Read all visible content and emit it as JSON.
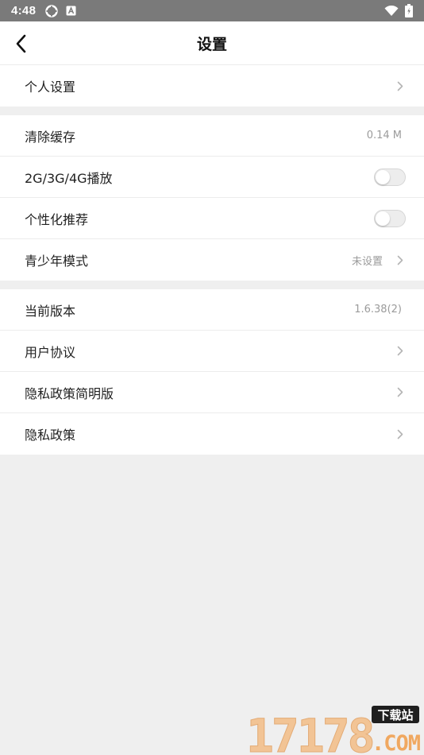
{
  "status_bar": {
    "time": "4:48",
    "left_icons": [
      "sync-icon",
      "app-notification-icon"
    ],
    "right_icons": [
      "wifi-icon",
      "battery-icon"
    ],
    "background_color": "#7a7a7a"
  },
  "nav": {
    "back_icon": "chevron-left-icon",
    "title": "设置"
  },
  "groups": [
    {
      "rows": [
        {
          "label": "个人设置",
          "value": "",
          "control": "chevron"
        }
      ]
    },
    {
      "rows": [
        {
          "label": "清除缓存",
          "value": "0.14 M",
          "control": "none"
        },
        {
          "label": "2G/3G/4G播放",
          "value": "",
          "control": "toggle",
          "on": false
        },
        {
          "label": "个性化推荐",
          "value": "",
          "control": "toggle",
          "on": false
        },
        {
          "label": "青少年模式",
          "value": "未设置",
          "control": "chevron"
        }
      ]
    },
    {
      "rows": [
        {
          "label": "当前版本",
          "value": "1.6.38(2)",
          "control": "none"
        },
        {
          "label": "用户协议",
          "value": "",
          "control": "chevron"
        },
        {
          "label": "隐私政策简明版",
          "value": "",
          "control": "chevron"
        },
        {
          "label": "隐私政策",
          "value": "",
          "control": "chevron"
        }
      ]
    }
  ],
  "watermark": {
    "text": "17178",
    "badge": "下载站",
    "domain": ".COM",
    "colors": {
      "digits": "#f3c18e",
      "badge_bg": "#1f1f1f",
      "com": "#f0a860"
    }
  },
  "colors": {
    "page_background": "#efefef",
    "row_background": "#ffffff",
    "secondary_text": "#9b9b9b"
  }
}
